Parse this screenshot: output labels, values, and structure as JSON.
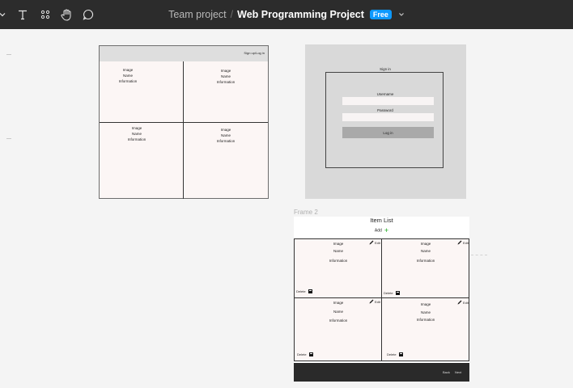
{
  "toolbar": {
    "tools": [
      {
        "name": "chevron-down-icon"
      },
      {
        "name": "text-tool-icon"
      },
      {
        "name": "components-icon"
      },
      {
        "name": "hand-tool-icon"
      },
      {
        "name": "comment-icon"
      }
    ],
    "breadcrumb": {
      "team": "Team project",
      "separator": "/",
      "project": "Web Programming Project",
      "badge": "Free"
    },
    "colors": {
      "bar": "#2c2c2c",
      "badge": "#0d99ff"
    }
  },
  "frame1": {
    "header_link": "Sign up/Log in",
    "cells": [
      {
        "image": "Image",
        "name": "Name",
        "info": "Information"
      },
      {
        "image": "Image",
        "name": "Name",
        "info": "Information"
      },
      {
        "image": "Image",
        "name": "Name",
        "info": "Information"
      },
      {
        "image": "Image",
        "name": "Name",
        "info": "Information"
      }
    ]
  },
  "frame2": {
    "title": "Sign in",
    "username_label": "Username",
    "password_label": "Password",
    "login_button": "Log in"
  },
  "frame3": {
    "frame_label": "Frame 2",
    "title": "Item List",
    "add_label": "Add",
    "add_icon": "+",
    "cards": [
      {
        "image": "Image",
        "name": "Name",
        "info": "Information",
        "edit": "Edit",
        "delete": "Delete"
      },
      {
        "image": "Image",
        "name": "Name",
        "info": "Information",
        "edit": "Edit",
        "delete": "Delete"
      },
      {
        "image": "Image",
        "name": "Name",
        "info": "Information",
        "edit": "Edit",
        "delete": "Delete"
      },
      {
        "image": "Image",
        "name": "Name",
        "info": "Information",
        "edit": "Edit",
        "delete": "Delete"
      }
    ],
    "back_label": "Back",
    "next_label": "Next"
  }
}
